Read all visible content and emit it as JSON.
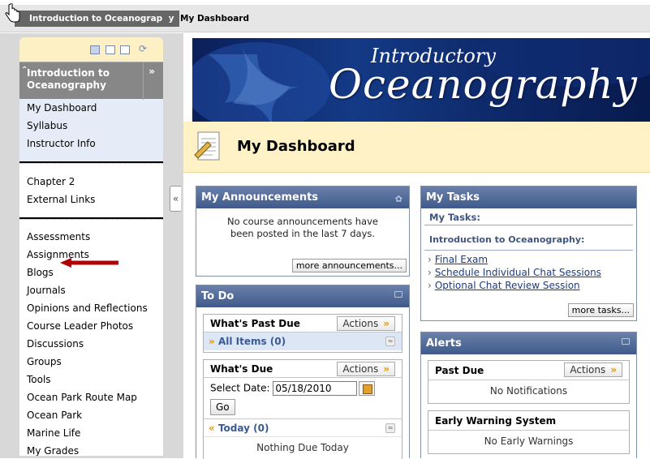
{
  "breadcrumb": {
    "course": "Introduction to Oceanography",
    "page": "My Dashboard"
  },
  "menu": {
    "course_title": "Introduction to Oceanography",
    "expand_glyph": "»",
    "collapse_glyph": "«",
    "section1": [
      "My Dashboard",
      "Syllabus",
      "Instructor Info"
    ],
    "section2": [
      "Chapter 2",
      "External Links"
    ],
    "section3": [
      "Assessments",
      "Assignments",
      "Blogs",
      "Journals",
      "Opinions and Reflections",
      "Course Leader Photos",
      "Discussions",
      "Groups",
      "Tools",
      "Ocean Park Route Map",
      "Ocean Park",
      "Marine Life",
      "My Grades"
    ]
  },
  "banner": {
    "line1": "Introductory",
    "line2": "Oceanography"
  },
  "page": {
    "title": "My Dashboard"
  },
  "announcements": {
    "title": "My Announcements",
    "message": "No course announcements have been posted in the last 7 days.",
    "more": "more announcements..."
  },
  "tasks": {
    "title": "My Tasks",
    "subtitle": "My Tasks:",
    "course": "Introduction to Oceanography:",
    "items": [
      "Final Exam",
      "Schedule Individual Chat Sessions",
      "Optional Chat Review Session"
    ],
    "more": "more tasks..."
  },
  "todo": {
    "title": "To Do",
    "past_due": "What's Past Due",
    "actions": "Actions",
    "all_items": "All Items (0)",
    "whats_due": "What's Due",
    "select_date_label": "Select Date:",
    "date_value": "05/18/2010",
    "go": "Go",
    "today": "Today (0)",
    "nothing_due": "Nothing Due Today"
  },
  "alerts": {
    "title": "Alerts",
    "past_due": "Past Due",
    "actions": "Actions",
    "no_notifications": "No Notifications",
    "early_warning": "Early Warning System",
    "no_early_warnings": "No Early Warnings"
  },
  "colors": {
    "module_header": "#4a6394",
    "menu_header": "#878787",
    "page_header_bg": "#fff2c6",
    "annotation_arrow": "#b00000"
  }
}
